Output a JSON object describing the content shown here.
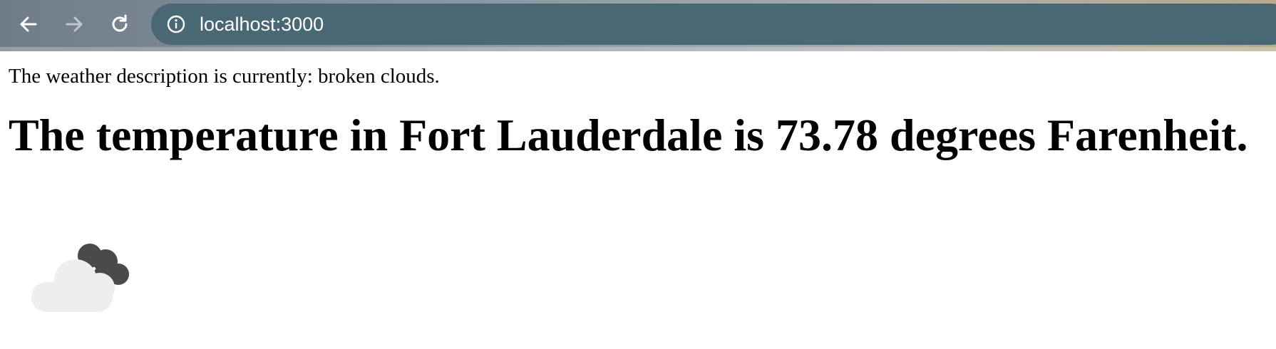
{
  "browser": {
    "url": "localhost:3000",
    "back_icon": "arrow-left-icon",
    "forward_icon": "arrow-right-icon",
    "reload_icon": "reload-icon",
    "info_icon": "info-icon"
  },
  "page": {
    "description": "The weather description is currently: broken clouds.",
    "temperature_heading": "The temperature in Fort Lauderdale is 73.78 degrees Farenheit.",
    "weather_icon": "broken-clouds-icon"
  },
  "colors": {
    "omnibox": "#4a6873",
    "light_cloud": "#eeeeee",
    "dark_cloud": "#4a4a4a"
  }
}
